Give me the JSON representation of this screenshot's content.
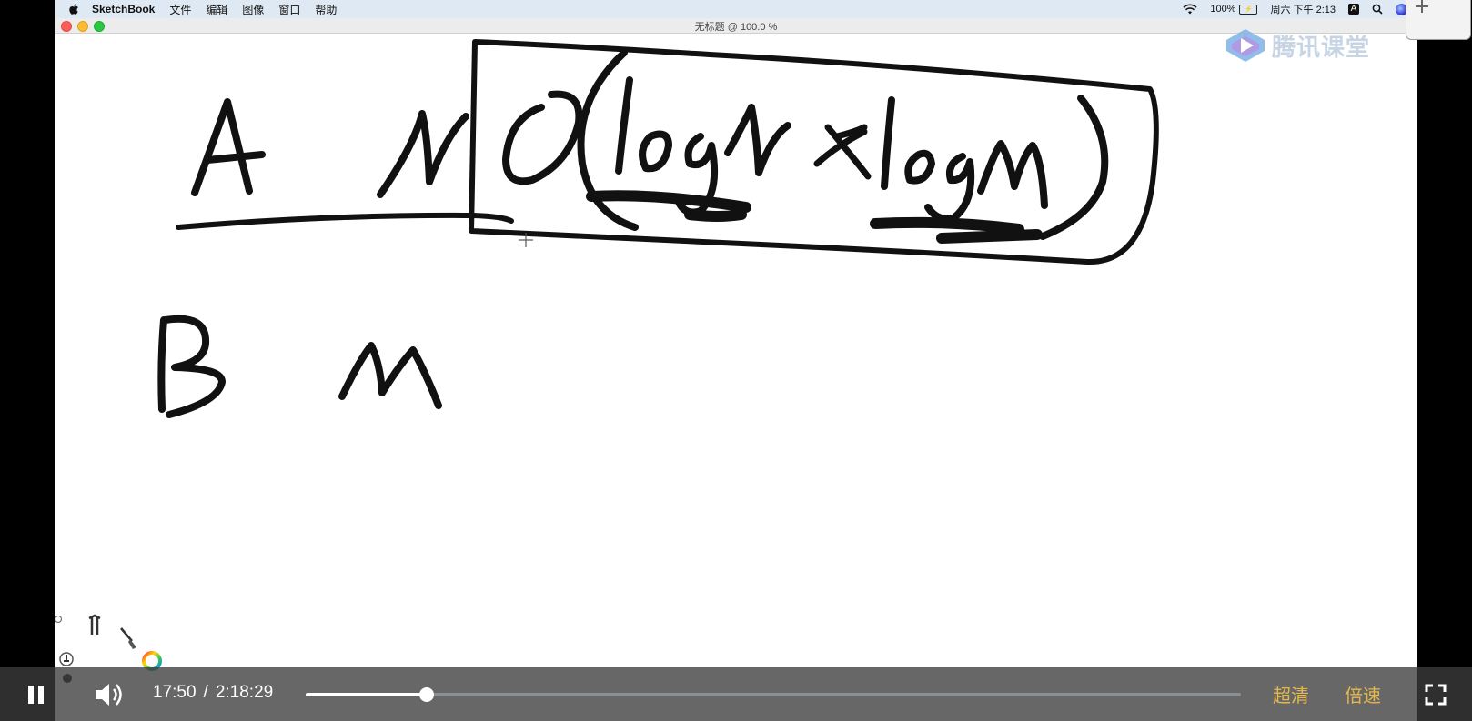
{
  "menubar": {
    "app_name": "SketchBook",
    "items": [
      "文件",
      "编辑",
      "图像",
      "窗口",
      "帮助"
    ],
    "battery_percent": "100%",
    "clock": "周六 下午 2:13",
    "input_method": "A"
  },
  "window": {
    "title": "无标题 @ 100.0 %"
  },
  "logo": {
    "text": "腾讯课堂"
  },
  "player": {
    "current_time": "17:50",
    "separator": "/",
    "duration": "2:18:29",
    "progress_fraction": 0.129,
    "quality_label": "超清",
    "speed_label": "倍速"
  },
  "colors": {
    "accent_gold": "#e6b84a",
    "menubar_bg": "#dfe9f3",
    "logo_blue": "#4a90d9"
  }
}
